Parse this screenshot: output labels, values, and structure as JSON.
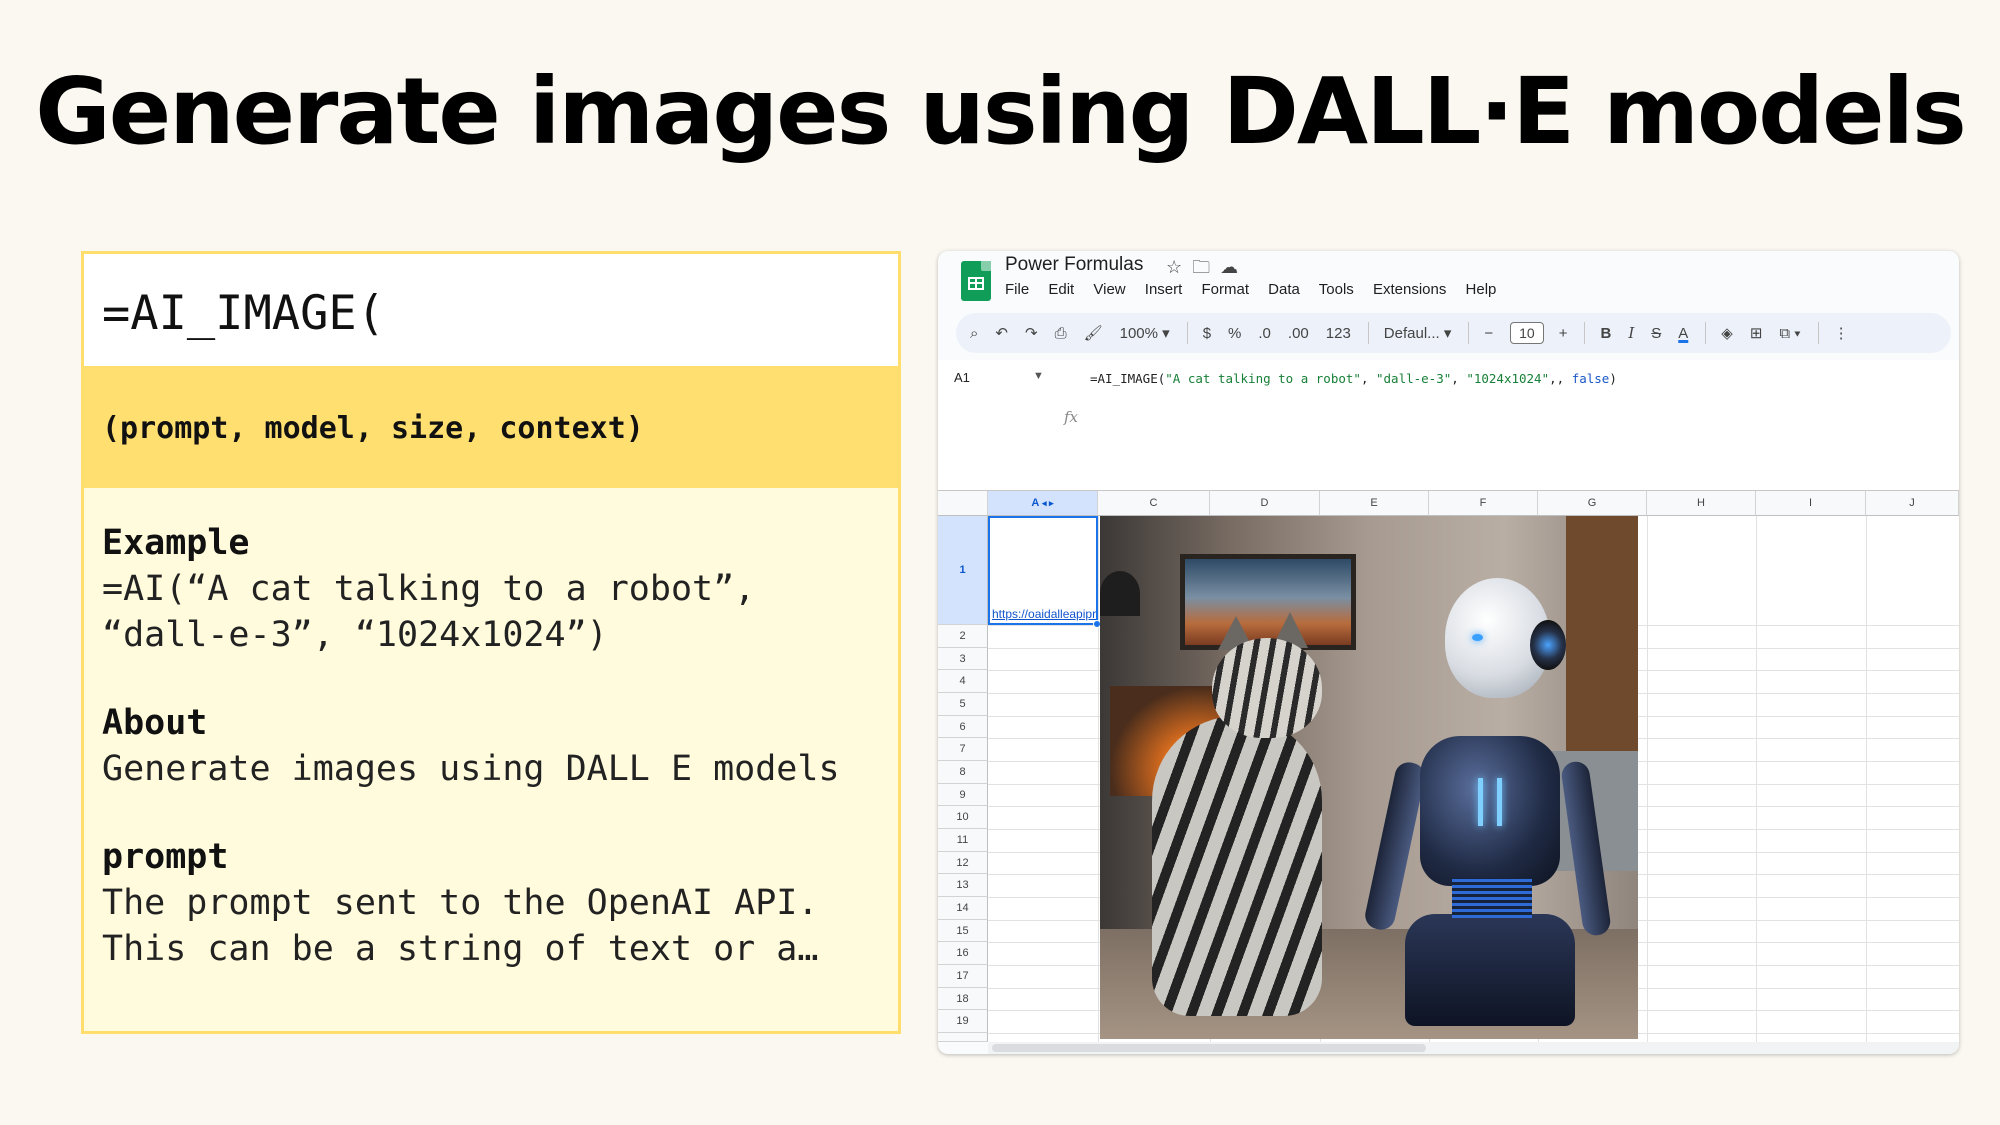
{
  "slide": {
    "title": "Generate images using DALL·E models"
  },
  "card": {
    "function_head": "=AI_IMAGE(",
    "signature": "(prompt, model, size, context)",
    "sections": [
      {
        "heading": "Example",
        "text": "=AI(“A cat talking to a robot”,\n“dall-e-3”, “1024x1024”)"
      },
      {
        "heading": "About",
        "text": "Generate images using DALL E models"
      },
      {
        "heading": "prompt",
        "text": "The prompt sent to the OpenAI API.\nThis can be a string of text or a…"
      }
    ]
  },
  "sheets": {
    "doc_title": "Power Formulas",
    "title_icons": [
      "star-icon",
      "move-to-folder-icon",
      "cloud-status-icon"
    ],
    "menu": [
      "File",
      "Edit",
      "View",
      "Insert",
      "Format",
      "Data",
      "Tools",
      "Extensions",
      "Help"
    ],
    "toolbar": {
      "zoom": "100%",
      "currency": "$",
      "percent": "%",
      "decrease_decimal": ".0",
      "increase_decimal": ".00",
      "number_format": "123",
      "font": "Defaul...",
      "font_size": "10",
      "font_decrease": "−",
      "font_increase": "+",
      "bold": "B",
      "italic": "I",
      "strike": "S",
      "text_color": "A"
    },
    "name_box": "A1",
    "formula_parts": {
      "fn": "=AI_IMAGE(",
      "arg1": "\"A cat talking to a robot\"",
      "arg2": "\"dall-e-3\"",
      "arg3": "\"1024x1024\"",
      "arg4": "false",
      "close": ")"
    },
    "fx_label": "fx",
    "columns": [
      "A",
      "C",
      "D",
      "E",
      "F",
      "G",
      "H",
      "I",
      "J"
    ],
    "selected_column": "A",
    "rows": [
      "1",
      "2",
      "3",
      "4",
      "5",
      "6",
      "7",
      "8",
      "9",
      "10",
      "11",
      "12",
      "13",
      "14",
      "15",
      "16",
      "17",
      "18",
      "19"
    ],
    "cell_A1_value": "https://oaidalleapiprodscus.blob.core.windows.net/private/org",
    "image_alt": "cat and robot in a living room"
  }
}
